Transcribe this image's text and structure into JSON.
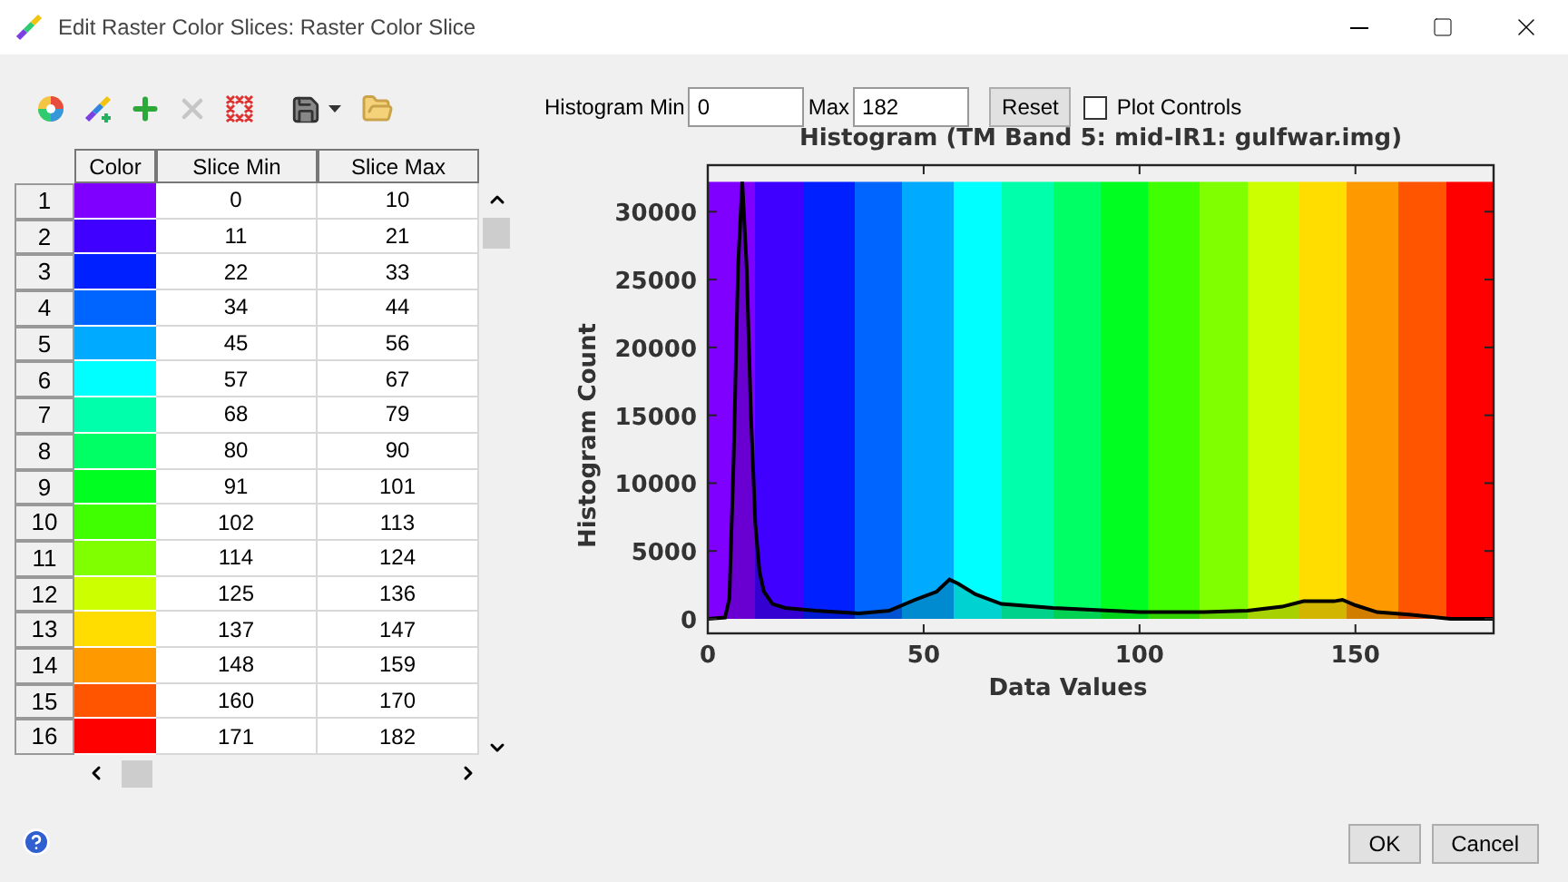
{
  "window": {
    "title": "Edit Raster Color Slices: Raster Color Slice"
  },
  "toolbar": {
    "buttons": [
      {
        "kind": "wheel",
        "disabled": false
      },
      {
        "kind": "ramp",
        "disabled": false
      },
      {
        "kind": "add",
        "disabled": false
      },
      {
        "kind": "delete",
        "disabled": true
      },
      {
        "kind": "clear",
        "disabled": false
      },
      {
        "kind": "save",
        "disabled": false
      },
      {
        "kind": "open",
        "disabled": false
      }
    ]
  },
  "table": {
    "columns": [
      "Color",
      "Slice Min",
      "Slice Max"
    ],
    "rows": [
      {
        "index": "1",
        "color": "#8000ff",
        "min": "0",
        "max": "10"
      },
      {
        "index": "2",
        "color": "#4000ff",
        "min": "11",
        "max": "21"
      },
      {
        "index": "3",
        "color": "#0020ff",
        "min": "22",
        "max": "33"
      },
      {
        "index": "4",
        "color": "#0064ff",
        "min": "34",
        "max": "44"
      },
      {
        "index": "5",
        "color": "#00aaff",
        "min": "45",
        "max": "56"
      },
      {
        "index": "6",
        "color": "#00ffff",
        "min": "57",
        "max": "67"
      },
      {
        "index": "7",
        "color": "#00ffaa",
        "min": "68",
        "max": "79"
      },
      {
        "index": "8",
        "color": "#00ff64",
        "min": "80",
        "max": "90"
      },
      {
        "index": "9",
        "color": "#00ff20",
        "min": "91",
        "max": "101"
      },
      {
        "index": "10",
        "color": "#40ff00",
        "min": "102",
        "max": "113"
      },
      {
        "index": "11",
        "color": "#80ff00",
        "min": "114",
        "max": "124"
      },
      {
        "index": "12",
        "color": "#ccff00",
        "min": "125",
        "max": "136"
      },
      {
        "index": "13",
        "color": "#ffdd00",
        "min": "137",
        "max": "147"
      },
      {
        "index": "14",
        "color": "#ff9900",
        "min": "148",
        "max": "159"
      },
      {
        "index": "15",
        "color": "#ff5500",
        "min": "160",
        "max": "170"
      },
      {
        "index": "16",
        "color": "#ff0000",
        "min": "171",
        "max": "182"
      }
    ]
  },
  "histogram_controls": {
    "min_label": "Histogram Min",
    "min_value": "0",
    "max_label": "Max",
    "max_value": "182",
    "reset": "Reset",
    "plot_controls": {
      "label": "Plot Controls",
      "checked": false
    }
  },
  "histogram": {
    "chart_data": {
      "type": "area",
      "title": "Histogram (TM Band 5: mid-IR1: gulfwar.img)",
      "xlabel": "Data Values",
      "ylabel": "Histogram Count",
      "xlim": [
        0,
        182
      ],
      "ylim": [
        -1070,
        33430
      ],
      "xticks": [
        0,
        50,
        100,
        150
      ],
      "yticks": [
        0,
        5000,
        10000,
        15000,
        20000,
        25000,
        30000
      ],
      "x": [
        0,
        4,
        5,
        6,
        7,
        8,
        9,
        10,
        11,
        12,
        13,
        15,
        18,
        25,
        35,
        42,
        48,
        53,
        56,
        58,
        62,
        68,
        80,
        100,
        115,
        125,
        133,
        138,
        145,
        147,
        150,
        155,
        163,
        172,
        182
      ],
      "series": [
        {
          "color": "#000000",
          "values": [
            0,
            100,
            1500,
            12000,
            26000,
            32200,
            26000,
            15000,
            7000,
            3500,
            2000,
            1100,
            800,
            600,
            400,
            600,
            1400,
            2000,
            2900,
            2600,
            1800,
            1100,
            800,
            500,
            500,
            600,
            900,
            1300,
            1300,
            1400,
            1000,
            500,
            300,
            0,
            0
          ]
        }
      ]
    }
  },
  "buttons": [
    {
      "label": "OK"
    },
    {
      "label": "Cancel"
    }
  ]
}
